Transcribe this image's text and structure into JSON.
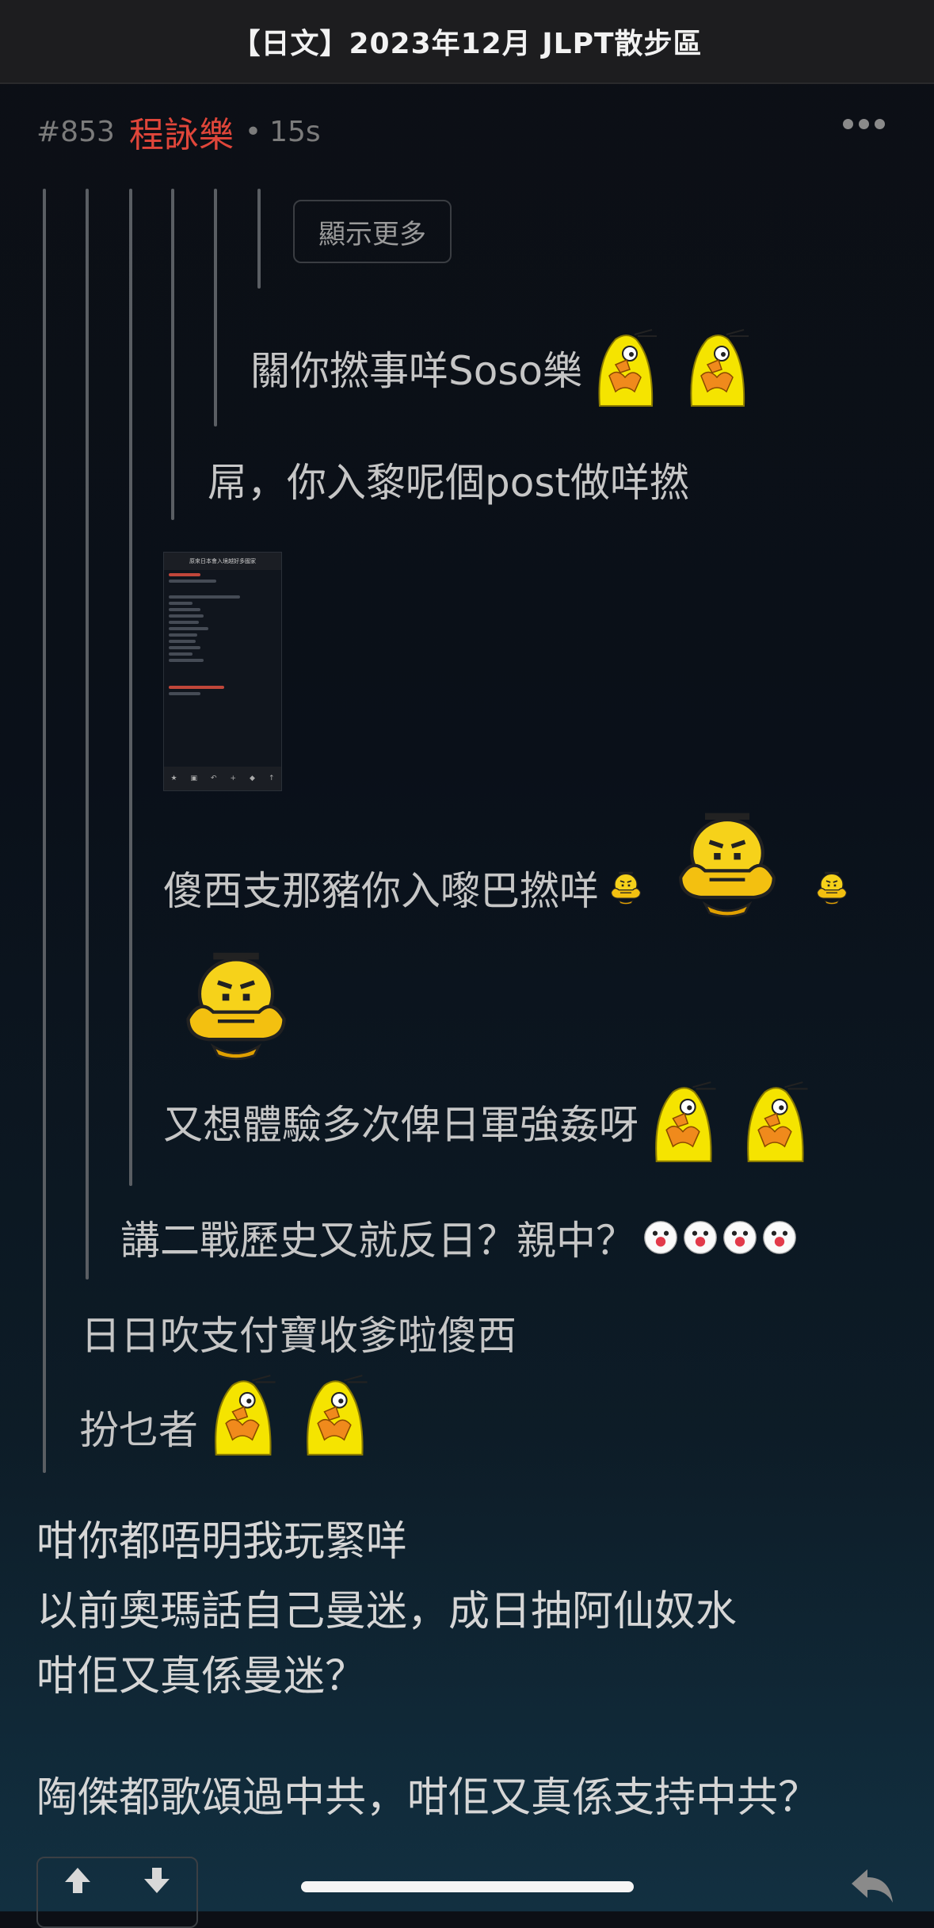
{
  "topbar": {
    "title": "【日文】2023年12月 JLPT散步區"
  },
  "post": {
    "number": "#853",
    "user": "程詠樂",
    "dot": "•",
    "time": "15s"
  },
  "quotes": {
    "show_more": "顯示更多",
    "q6": "關你撚事咩Soso樂",
    "q5": "屌，你入黎呢個post做咩撚",
    "q4a": "傻西支那豬你入嚟巴撚咩",
    "q4b": "又想體驗多次俾日軍強姦呀",
    "q3": "講二戰歷史又就反日？親中？",
    "q2": "日日吹支付寶收爹啦傻西",
    "q1": "扮乜者"
  },
  "thumbnail": {
    "header": "原來日本會入境越好多國家"
  },
  "body": {
    "line1": "咁你都唔明我玩緊咩",
    "line2": "以前奧瑪話自己曼迷，成日抽阿仙奴水",
    "line3": "咁佢又真係曼迷？",
    "line4": "陶傑都歌頌過中共，咁佢又真係支持中共？"
  },
  "icons": {
    "more": "more-dots-icon",
    "upvote": "arrow-up-icon",
    "downvote": "arrow-down-icon",
    "reply": "reply-icon",
    "chick": "chick-emoji-icon",
    "face": "angry-face-emoji-icon",
    "clown": "clown-emoji-icon"
  },
  "colors": {
    "username": "#e0463a",
    "topbar": "#1d1d1f",
    "accent_yellow": "#f5e400"
  }
}
